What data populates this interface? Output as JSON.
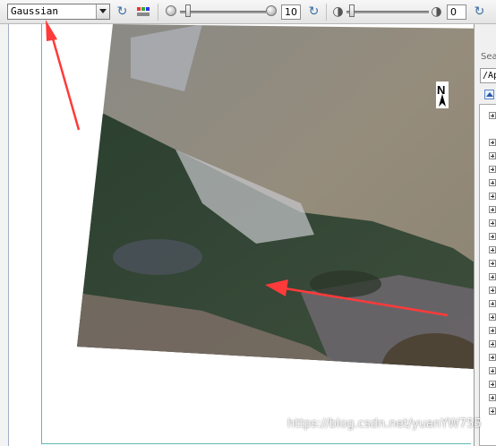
{
  "toolbar": {
    "stretch_type": "Gaussian",
    "sharpen_value": "10",
    "transparency_value": "0",
    "icons": [
      "dropdown-arrow-icon",
      "refresh-icon",
      "color-table-icon",
      "brightness-icon",
      "refresh-icon",
      "transparency-icon",
      "refresh-icon"
    ]
  },
  "right_panel": {
    "search_label": "Sea",
    "path_value": "/Ap"
  },
  "watermark": "https://blog.csdn.net/yuanYW755",
  "colors": {
    "arrow": "#ff3a3a",
    "frame": "#5fb7b7"
  }
}
